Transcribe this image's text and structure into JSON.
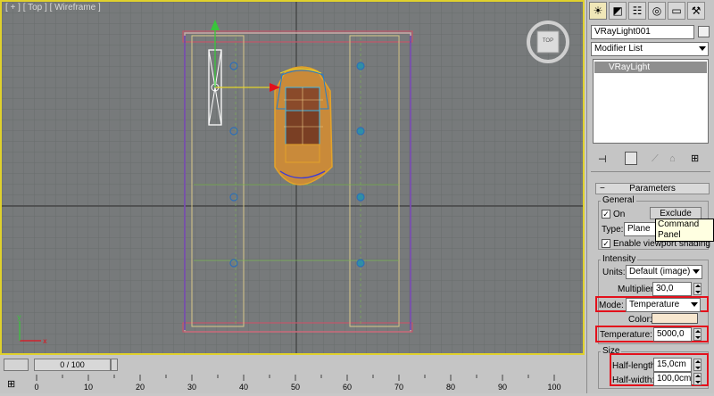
{
  "viewport": {
    "label": "[ + ] [ Top ] [ Wireframe ]",
    "viewcube_label": "TOP"
  },
  "panel": {
    "object_name": "VRayLight001",
    "modifier_list": "Modifier List",
    "stack_item": "VRayLight",
    "rollout_title": "Parameters",
    "general": {
      "title": "General",
      "on_label": "On",
      "exclude_button": "Exclude",
      "type_label": "Type:",
      "type_value": "Plane",
      "viewport_shading": "Enable viewport shading"
    },
    "tooltip": "Command Panel",
    "intensity": {
      "title": "Intensity",
      "units_label": "Units:",
      "units_value": "Default (image)",
      "multiplier_label": "Multiplier:",
      "multiplier_value": "30,0",
      "mode_label": "Mode:",
      "mode_value": "Temperature",
      "color_label": "Color:",
      "color_swatch": "#f7e7cf",
      "temperature_label": "Temperature:",
      "temperature_value": "5000,0"
    },
    "size": {
      "title": "Size",
      "half_length_label": "Half-length:",
      "half_length_value": "15,0cm",
      "half_width_label": "Half-width:",
      "half_width_value": "100,0cm"
    }
  },
  "timeline": {
    "frame_display": "0 / 100",
    "ticks": [
      "0",
      "10",
      "20",
      "30",
      "40",
      "50",
      "60",
      "70",
      "80",
      "90",
      "100"
    ]
  },
  "colors": {
    "viewport_bg": "#777a7b",
    "active_border": "#e0d12c",
    "highlight": "#e3111c"
  }
}
